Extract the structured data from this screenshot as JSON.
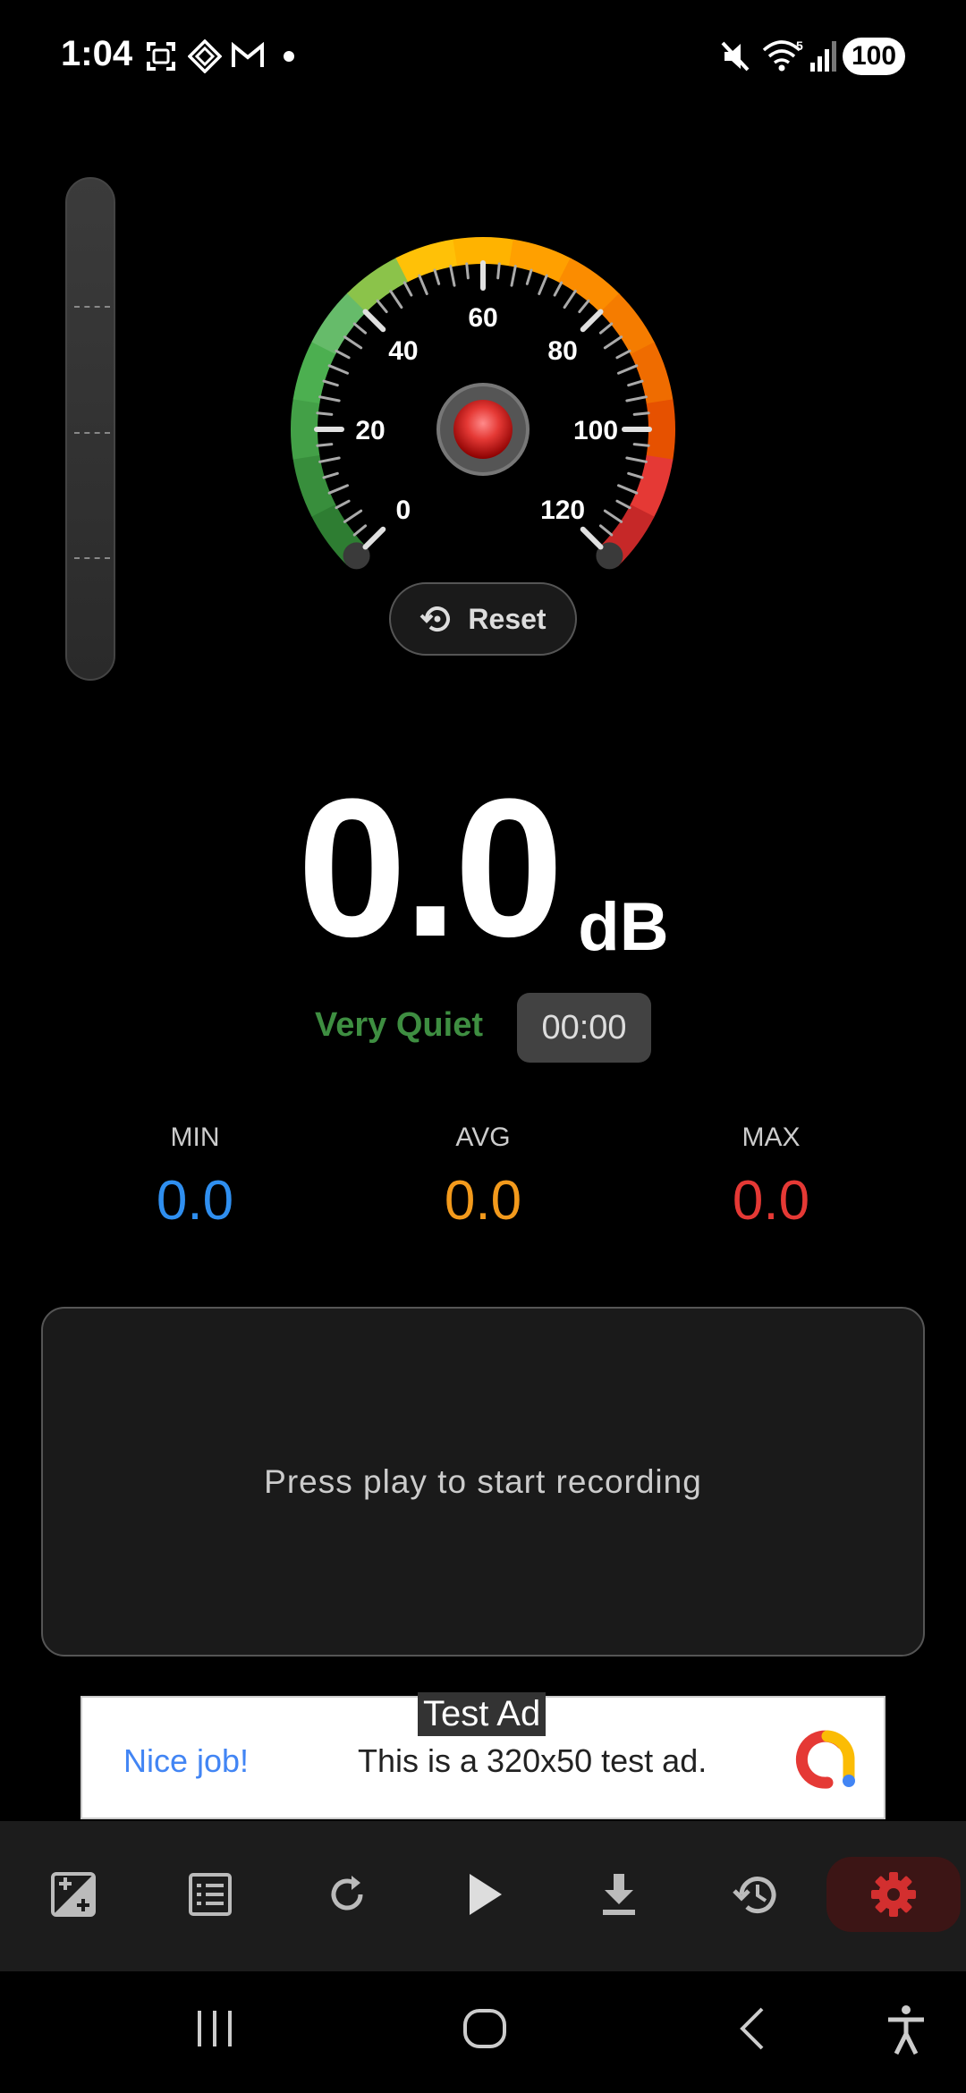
{
  "status_bar": {
    "time": "1:04",
    "battery": "100",
    "left_icons": [
      "screenshot-icon",
      "app-icon",
      "gmail-icon",
      "dot-icon"
    ],
    "right_icons": [
      "mute-icon",
      "wifi-icon",
      "signal-icon"
    ]
  },
  "gauge": {
    "scale_labels": [
      "0",
      "20",
      "40",
      "60",
      "80",
      "100",
      "120"
    ],
    "needle_value": 0,
    "range": [
      0,
      120
    ],
    "reset_label": "Reset"
  },
  "reading": {
    "value": "0.0",
    "unit": "dB",
    "level_label": "Very Quiet",
    "level_color": "#3e8e41",
    "timer": "00:00"
  },
  "stats": {
    "min_label": "MIN",
    "min_value": "0.0",
    "min_color": "#2f8ff0",
    "avg_label": "AVG",
    "avg_value": "0.0",
    "avg_color": "#f39a1c",
    "max_label": "MAX",
    "max_value": "0.0",
    "max_color": "#e53935"
  },
  "chart_panel": {
    "message": "Press play to start recording"
  },
  "ad": {
    "tag": "Test Ad",
    "headline": "Nice job!",
    "message": "This is a 320x50 test ad."
  },
  "toolbar": {
    "items": [
      "exposure-icon",
      "list-icon",
      "refresh-icon",
      "play-icon",
      "download-icon",
      "history-icon",
      "settings-icon"
    ],
    "active": "settings-icon",
    "accent": "#d32f2f"
  },
  "nav_bar": {
    "items": [
      "recents-icon",
      "home-icon",
      "back-icon",
      "accessibility-icon"
    ]
  }
}
